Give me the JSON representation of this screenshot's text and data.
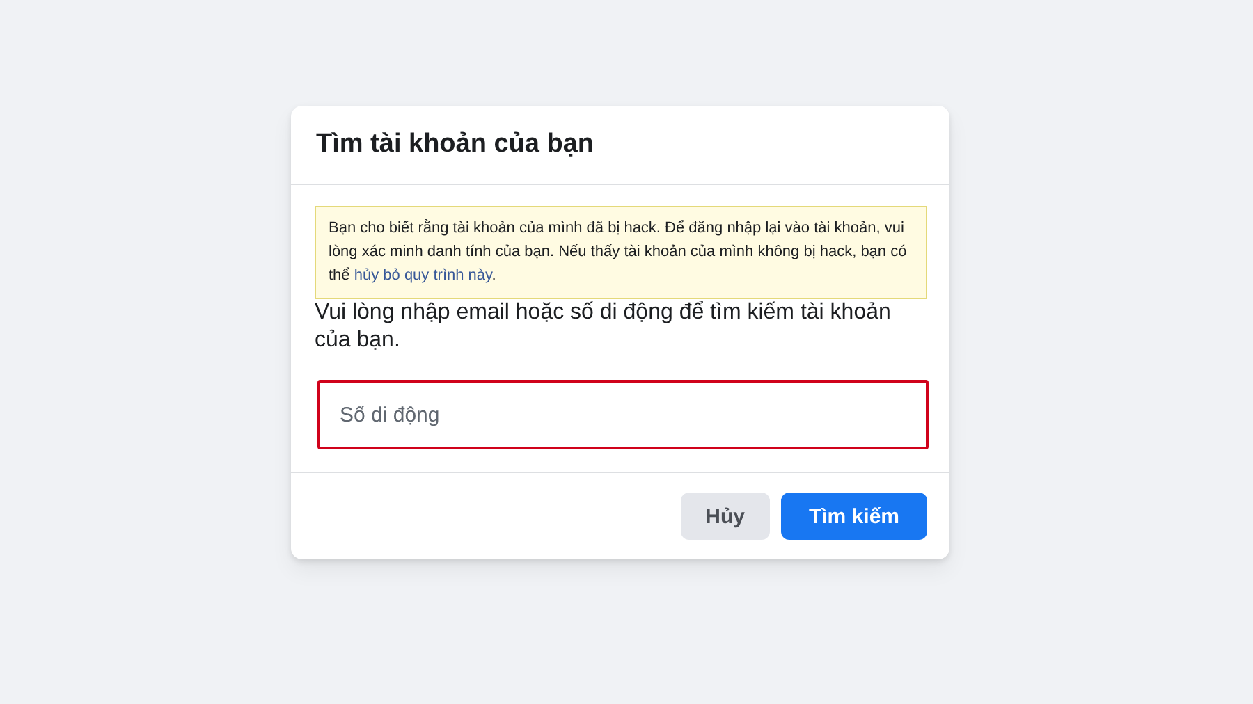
{
  "dialog": {
    "title": "Tìm tài khoản của bạn",
    "notice": {
      "text": "Bạn cho biết rằng tài khoản của mình đã bị hack. Để đăng nhập lại vào tài khoản, vui lòng xác minh danh tính của bạn. Nếu thấy tài khoản của mình không bị hack, bạn có thể ",
      "link": "hủy bỏ quy trình này",
      "after": "."
    },
    "instruction": "Vui lòng nhập email hoặc số di động để tìm kiếm tài khoản của bạn.",
    "field": {
      "placeholder": "Số di động"
    },
    "buttons": [
      {
        "label": "Hủy",
        "kind": "secondary"
      },
      {
        "label": "Tìm kiếm",
        "kind": "primary"
      }
    ]
  }
}
